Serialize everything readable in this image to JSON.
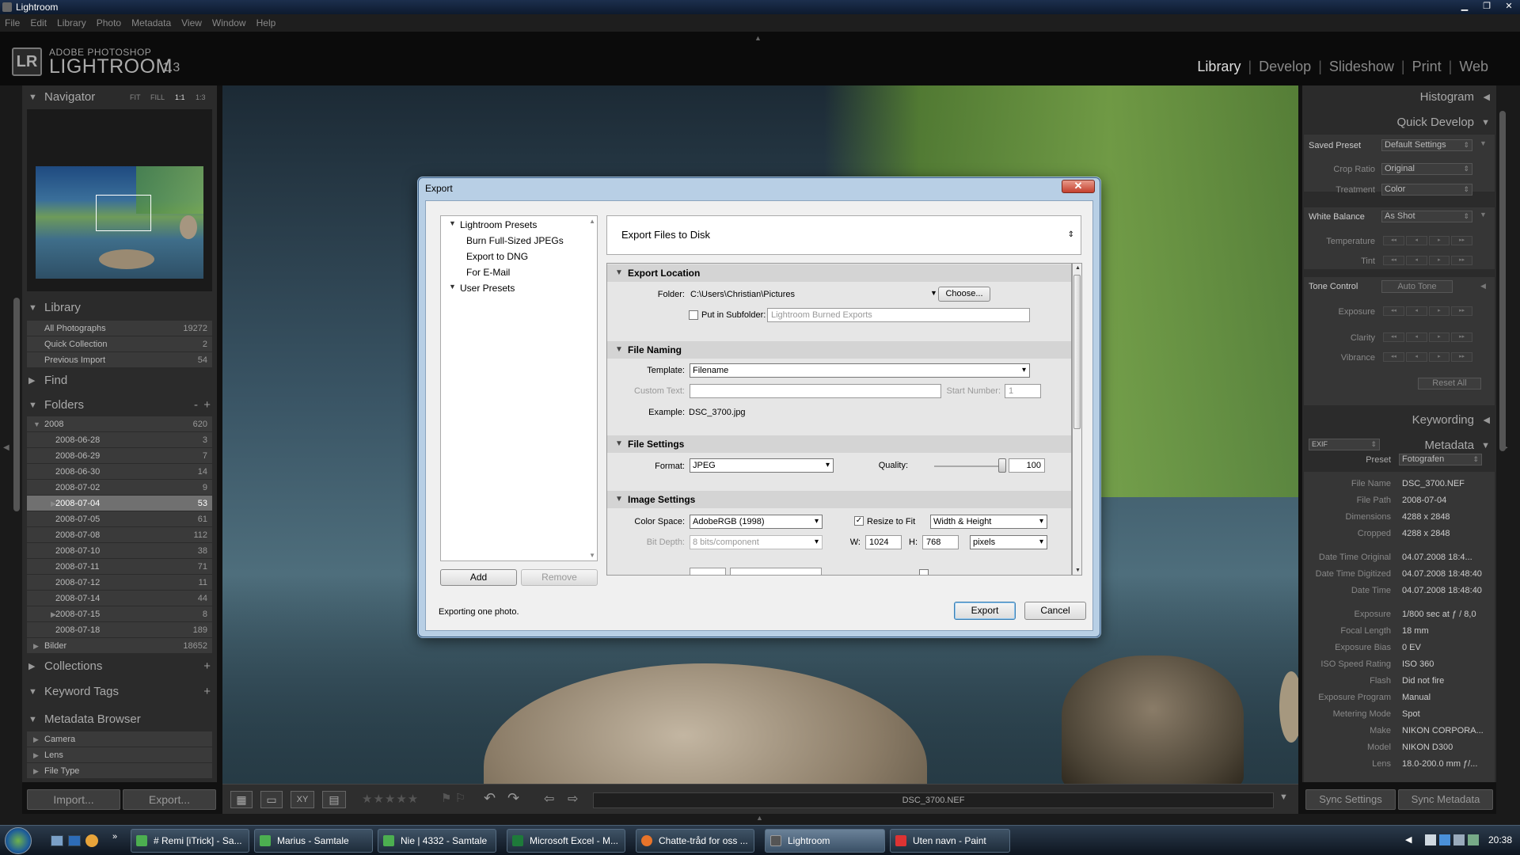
{
  "window": {
    "title": "Lightroom"
  },
  "menu": [
    "File",
    "Edit",
    "Library",
    "Photo",
    "Metadata",
    "View",
    "Window",
    "Help"
  ],
  "logo": {
    "badge": "LR",
    "sub": "ADOBE PHOTOSHOP",
    "main": "LIGHTROOM",
    "version": "1.3"
  },
  "modules": {
    "library": "Library",
    "develop": "Develop",
    "slideshow": "Slideshow",
    "print": "Print",
    "web": "Web"
  },
  "navigator": {
    "title": "Navigator",
    "fit": "FIT",
    "fill": "FILL",
    "one": "1:1",
    "ratio": "1:3"
  },
  "library": {
    "title": "Library",
    "items": [
      {
        "label": "All Photographs",
        "count": "19272"
      },
      {
        "label": "Quick Collection",
        "count": "2"
      },
      {
        "label": "Previous Import",
        "count": "54"
      }
    ]
  },
  "find": {
    "title": "Find"
  },
  "folders": {
    "title": "Folders",
    "minus": "-",
    "plus": "+",
    "items": [
      {
        "label": "2008",
        "count": "620"
      },
      {
        "label": "2008-06-28",
        "count": "3"
      },
      {
        "label": "2008-06-29",
        "count": "7"
      },
      {
        "label": "2008-06-30",
        "count": "14"
      },
      {
        "label": "2008-07-02",
        "count": "9"
      },
      {
        "label": "2008-07-04",
        "count": "53"
      },
      {
        "label": "2008-07-05",
        "count": "61"
      },
      {
        "label": "2008-07-08",
        "count": "112"
      },
      {
        "label": "2008-07-10",
        "count": "38"
      },
      {
        "label": "2008-07-11",
        "count": "71"
      },
      {
        "label": "2008-07-12",
        "count": "11"
      },
      {
        "label": "2008-07-14",
        "count": "44"
      },
      {
        "label": "2008-07-15",
        "count": "8"
      },
      {
        "label": "2008-07-18",
        "count": "189"
      },
      {
        "label": "Bilder",
        "count": "18652"
      }
    ]
  },
  "collections": {
    "title": "Collections",
    "plus": "+"
  },
  "keyword_tags": {
    "title": "Keyword Tags",
    "plus": "+"
  },
  "metadata_browser": {
    "title": "Metadata Browser",
    "items": [
      "Camera",
      "Lens",
      "File Type"
    ]
  },
  "left_buttons": {
    "import": "Import...",
    "export": "Export..."
  },
  "right": {
    "histogram": "Histogram",
    "quick_develop": "Quick Develop",
    "saved_preset_label": "Saved Preset",
    "saved_preset_value": "Default Settings",
    "crop_ratio_label": "Crop Ratio",
    "crop_ratio_value": "Original",
    "treatment_label": "Treatment",
    "treatment_value": "Color",
    "white_balance_label": "White Balance",
    "white_balance_value": "As Shot",
    "temperature_label": "Temperature",
    "tint_label": "Tint",
    "tone_control_label": "Tone Control",
    "auto_tone": "Auto Tone",
    "exposure_label": "Exposure",
    "clarity_label": "Clarity",
    "vibrance_label": "Vibrance",
    "reset_all": "Reset All",
    "keywording": "Keywording",
    "metadata": "Metadata",
    "metadata_set": "EXIF",
    "preset_label": "Preset",
    "preset_value": "Fotografen",
    "fields": [
      {
        "label": "File Name",
        "value": "DSC_3700.NEF"
      },
      {
        "label": "File Path",
        "value": "2008-07-04"
      },
      {
        "label": "Dimensions",
        "value": "4288 x 2848"
      },
      {
        "label": "Cropped",
        "value": "4288 x 2848"
      },
      {
        "label": "Date Time Original",
        "value": "04.07.2008 18:4..."
      },
      {
        "label": "Date Time Digitized",
        "value": "04.07.2008 18:48:40"
      },
      {
        "label": "Date Time",
        "value": "04.07.2008 18:48:40"
      },
      {
        "label": "Exposure",
        "value": "1/800 sec at ƒ / 8,0"
      },
      {
        "label": "Focal Length",
        "value": "18 mm"
      },
      {
        "label": "Exposure Bias",
        "value": "0 EV"
      },
      {
        "label": "ISO Speed Rating",
        "value": "ISO 360"
      },
      {
        "label": "Flash",
        "value": "Did not fire"
      },
      {
        "label": "Exposure Program",
        "value": "Manual"
      },
      {
        "label": "Metering Mode",
        "value": "Spot"
      },
      {
        "label": "Make",
        "value": "NIKON CORPORA..."
      },
      {
        "label": "Model",
        "value": "NIKON D300"
      },
      {
        "label": "Lens",
        "value": "18.0-200.0 mm ƒ/..."
      }
    ],
    "sync_settings": "Sync Settings",
    "sync_metadata": "Sync Metadata"
  },
  "toolbar": {
    "filename": "DSC_3700.NEF"
  },
  "dialog": {
    "title": "Export",
    "presets": {
      "group1": "Lightroom Presets",
      "items": [
        "Burn Full-Sized JPEGs",
        "Export to DNG",
        "For E-Mail"
      ],
      "group2": "User Presets"
    },
    "add": "Add",
    "remove": "Remove",
    "destination": "Export Files to Disk",
    "export_location": {
      "title": "Export Location",
      "folder_label": "Folder:",
      "folder_value": "C:\\Users\\Christian\\Pictures",
      "choose": "Choose...",
      "subfolder_label": "Put in Subfolder:",
      "subfolder_placeholder": "Lightroom Burned Exports"
    },
    "file_naming": {
      "title": "File Naming",
      "template_label": "Template:",
      "template_value": "Filename",
      "custom_text_label": "Custom Text:",
      "start_number_label": "Start Number:",
      "start_number_value": "1",
      "example_label": "Example:",
      "example_value": "DSC_3700.jpg"
    },
    "file_settings": {
      "title": "File Settings",
      "format_label": "Format:",
      "format_value": "JPEG",
      "quality_label": "Quality:",
      "quality_value": "100"
    },
    "image_settings": {
      "title": "Image Settings",
      "color_space_label": "Color Space:",
      "color_space_value": "AdobeRGB (1998)",
      "bit_depth_label": "Bit Depth:",
      "bit_depth_value": "8 bits/component",
      "resize_label": "Resize to Fit",
      "resize_mode": "Width & Height",
      "w_label": "W:",
      "w_value": "1024",
      "h_label": "H:",
      "h_value": "768",
      "unit": "pixels"
    },
    "status": "Exporting one photo.",
    "export": "Export",
    "cancel": "Cancel"
  },
  "taskbar": {
    "items": [
      "# Remi [iTrick] - Sa...",
      "Marius - Samtale",
      "Nie | 4332 - Samtale",
      "Microsoft Excel - M...",
      "Chatte-tråd for oss ...",
      "Lightroom",
      "Uten navn - Paint"
    ],
    "clock": "20:38"
  },
  "colors": {
    "accent": "#e6e6e6",
    "dialog_frame": "#b8cfe5"
  }
}
